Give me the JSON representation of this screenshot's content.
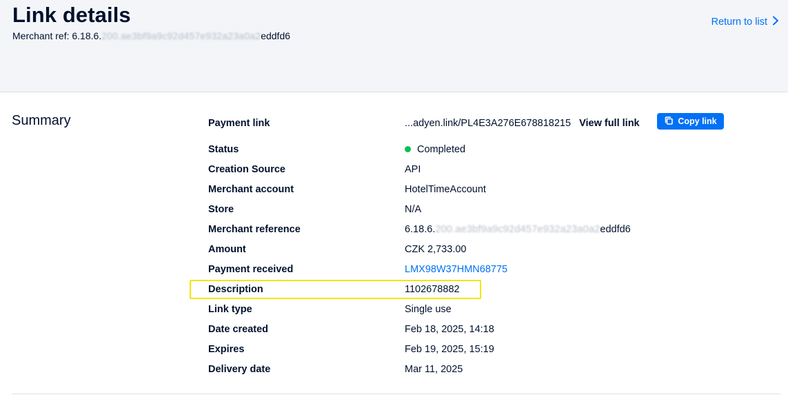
{
  "header": {
    "title": "Link details",
    "merchant_ref_label": "Merchant ref: 6.18.6.",
    "merchant_ref_blurred": "200.ae3bf9a9c92d457e932a23a0a2",
    "merchant_ref_suffix": "eddfd6",
    "return_label": "Return to list",
    "return_icon": "chevron-right-icon"
  },
  "summary": {
    "title": "Summary",
    "payment_link": {
      "label": "Payment link",
      "value": "...adyen.link/PL4E3A276E678818215",
      "view_full_label": "View full link",
      "copy_label": "Copy link",
      "copy_icon": "copy-icon"
    },
    "status": {
      "label": "Status",
      "value": "Completed",
      "color": "#0abf53"
    },
    "creation_source": {
      "label": "Creation Source",
      "value": "API"
    },
    "merchant_account": {
      "label": "Merchant account",
      "value": "HotelTimeAccount"
    },
    "store": {
      "label": "Store",
      "value": "N/A"
    },
    "merchant_reference": {
      "label": "Merchant reference",
      "value_prefix": "6.18.6.",
      "value_blurred": "200.ae3bf9a9c92d457e932a23a0a2",
      "value_suffix": "eddfd6"
    },
    "amount": {
      "label": "Amount",
      "value": "CZK 2,733.00"
    },
    "payment_received": {
      "label": "Payment received",
      "value": "LMX98W37HMN68775"
    },
    "description": {
      "label": "Description",
      "value": "1102678882"
    },
    "link_type": {
      "label": "Link type",
      "value": "Single use"
    },
    "date_created": {
      "label": "Date created",
      "value": "Feb 18, 2025, 14:18"
    },
    "expires": {
      "label": "Expires",
      "value": "Feb 19, 2025, 15:19"
    },
    "delivery_date": {
      "label": "Delivery date",
      "value": "Mar 11, 2025"
    }
  },
  "colors": {
    "accent": "#0070f5",
    "highlight": "#f4e50a",
    "header_bg": "#f3f5f9"
  }
}
